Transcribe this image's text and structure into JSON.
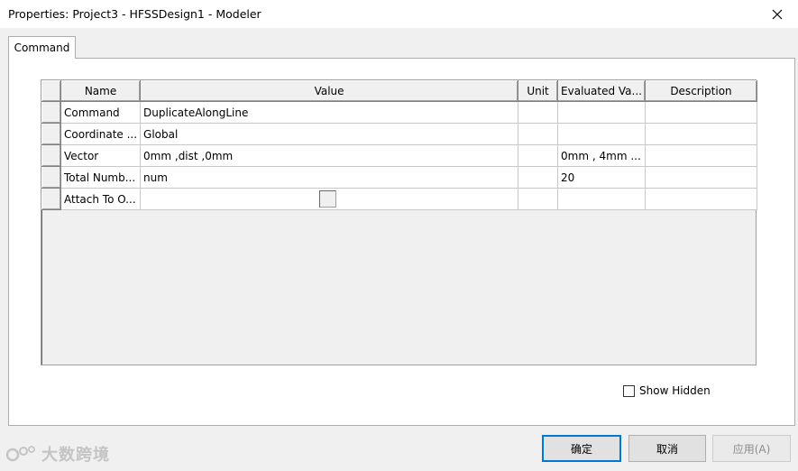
{
  "window": {
    "title": "Properties: Project3 - HFSSDesign1 - Modeler",
    "close_glyph": "✕"
  },
  "tabs": [
    {
      "label": "Command",
      "active": true
    }
  ],
  "grid": {
    "columns": [
      "Name",
      "Value",
      "Unit",
      "Evaluated Va...",
      "Description"
    ],
    "rows": [
      {
        "name": "Command",
        "value": "DuplicateAlongLine",
        "unit": "",
        "evaluated": "",
        "description": ""
      },
      {
        "name": "Coordinate ...",
        "value": "Global",
        "unit": "",
        "evaluated": "",
        "description": ""
      },
      {
        "name": "Vector",
        "value": "0mm ,dist ,0mm",
        "unit": "",
        "evaluated": "0mm , 4mm ...",
        "description": ""
      },
      {
        "name": "Total Numb...",
        "value": "num",
        "unit": "",
        "evaluated": "20",
        "description": ""
      },
      {
        "name": "Attach To O...",
        "value": "",
        "unit": "",
        "evaluated": "",
        "description": "",
        "checkbox": true,
        "checked": false
      }
    ]
  },
  "show_hidden": {
    "label": "Show Hidden",
    "checked": false
  },
  "buttons": {
    "ok": "确定",
    "cancel": "取消",
    "apply": "应用(A)"
  },
  "watermark": {
    "text": "大数跨境"
  }
}
